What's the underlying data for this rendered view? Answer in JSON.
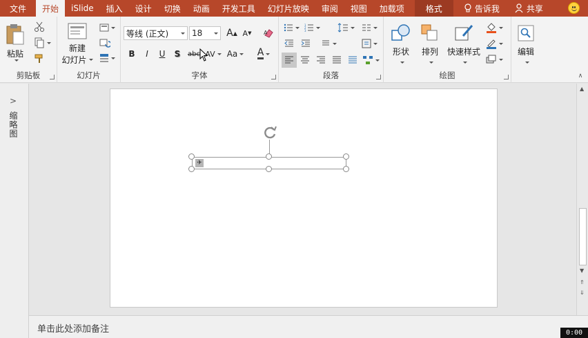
{
  "tabs": {
    "file": "文件",
    "home": "开始",
    "islide": "iSlide",
    "insert": "插入",
    "design": "设计",
    "transitions": "切换",
    "animations": "动画",
    "developer": "开发工具",
    "slideshow": "幻灯片放映",
    "review": "审阅",
    "view": "视图",
    "addins": "加载项",
    "format": "格式"
  },
  "tellme": "告诉我",
  "share": "共享",
  "groups": {
    "clipboard": "剪贴板",
    "slides": "幻灯片",
    "font": "字体",
    "paragraph": "段落",
    "drawing": "绘图"
  },
  "buttons": {
    "paste": "粘贴",
    "new_slide_line1": "新建",
    "new_slide_line2": "幻灯片",
    "shapes": "形状",
    "arrange": "排列",
    "quick_styles": "快速样式",
    "edit": "编辑",
    "bold": "B",
    "italic": "I",
    "underline": "U",
    "shadow": "S",
    "strikethrough": "abc",
    "spacing": "AV",
    "case": "Aa",
    "fontcolor": "A",
    "grow": "A",
    "shrink": "A"
  },
  "font": {
    "name": "等线 (正文)",
    "size": "18"
  },
  "left_panel": {
    "label": "缩略图"
  },
  "notes": {
    "placeholder": "单击此处添加备注"
  },
  "timer": "0:00",
  "colors": {
    "accent": "#b7472a",
    "ribbon": "#f3f3f3"
  }
}
